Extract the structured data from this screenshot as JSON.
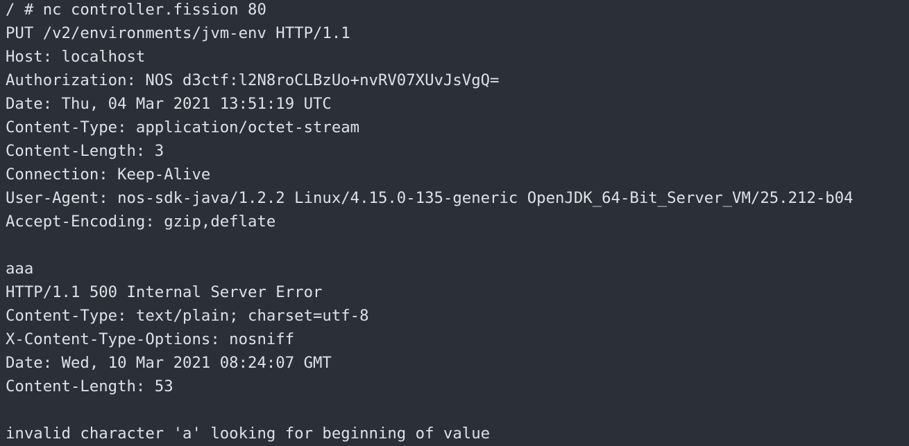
{
  "terminal": {
    "lines": [
      "/ # nc controller.fission 80",
      "PUT /v2/environments/jvm-env HTTP/1.1",
      "Host: localhost",
      "Authorization: NOS d3ctf:l2N8roCLBzUo+nvRV07XUvJsVgQ=",
      "Date: Thu, 04 Mar 2021 13:51:19 UTC",
      "Content-Type: application/octet-stream",
      "Content-Length: 3",
      "Connection: Keep-Alive",
      "User-Agent: nos-sdk-java/1.2.2 Linux/4.15.0-135-generic OpenJDK_64-Bit_Server_VM/25.212-b04",
      "Accept-Encoding: gzip,deflate",
      "",
      "aaa",
      "HTTP/1.1 500 Internal Server Error",
      "Content-Type: text/plain; charset=utf-8",
      "X-Content-Type-Options: nosniff",
      "Date: Wed, 10 Mar 2021 08:24:07 GMT",
      "Content-Length: 53",
      "",
      "invalid character 'a' looking for beginning of value"
    ]
  }
}
